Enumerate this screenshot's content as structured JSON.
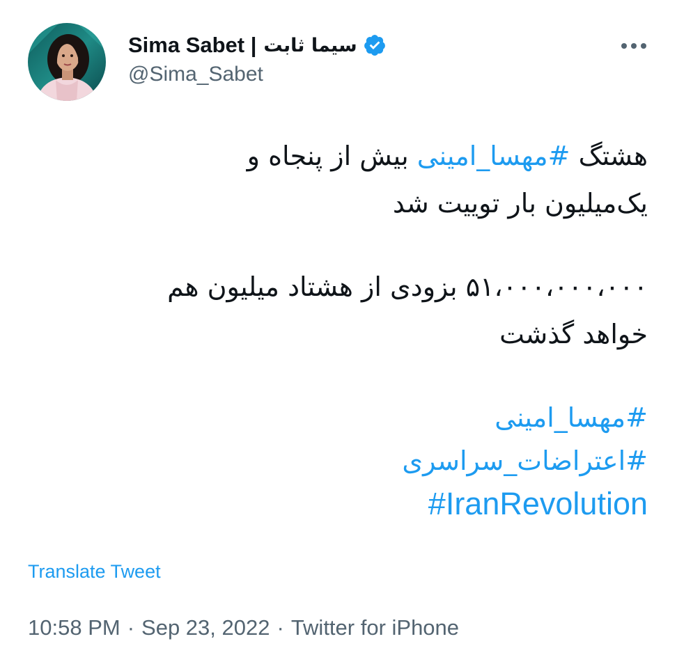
{
  "author": {
    "display_name": "Sima Sabet |",
    "display_name_fa": "سیما ثابت",
    "handle": "@Sima_Sabet",
    "verified": true,
    "avatar": "profile-photo-avatar",
    "verified_icon": "verified-badge-icon"
  },
  "menu": {
    "icon": "more-options-icon"
  },
  "tweet": {
    "line1_prefix": "هشتگ ",
    "line1_hashtag": "#مهسا_امینی",
    "line1_suffix": " بیش از پنجاه و",
    "line2": "یک‌میلیون بار توییت شد",
    "line3": "۵۱،۰۰۰،۰۰۰،۰۰۰ بزودی از هشتاد میلیون هم",
    "line4": "خواهد گذشت",
    "hashtags": [
      "#مهسا_امینی",
      "#اعتراضات_سراسری",
      "#IranRevolution"
    ]
  },
  "actions": {
    "translate_label": "Translate Tweet"
  },
  "meta": {
    "time": "10:58 PM",
    "date": "Sep 23, 2022",
    "source": "Twitter for iPhone",
    "separator": "·"
  },
  "colors": {
    "link": "#1d9bf0",
    "text": "#0f1419",
    "secondary": "#536471"
  }
}
